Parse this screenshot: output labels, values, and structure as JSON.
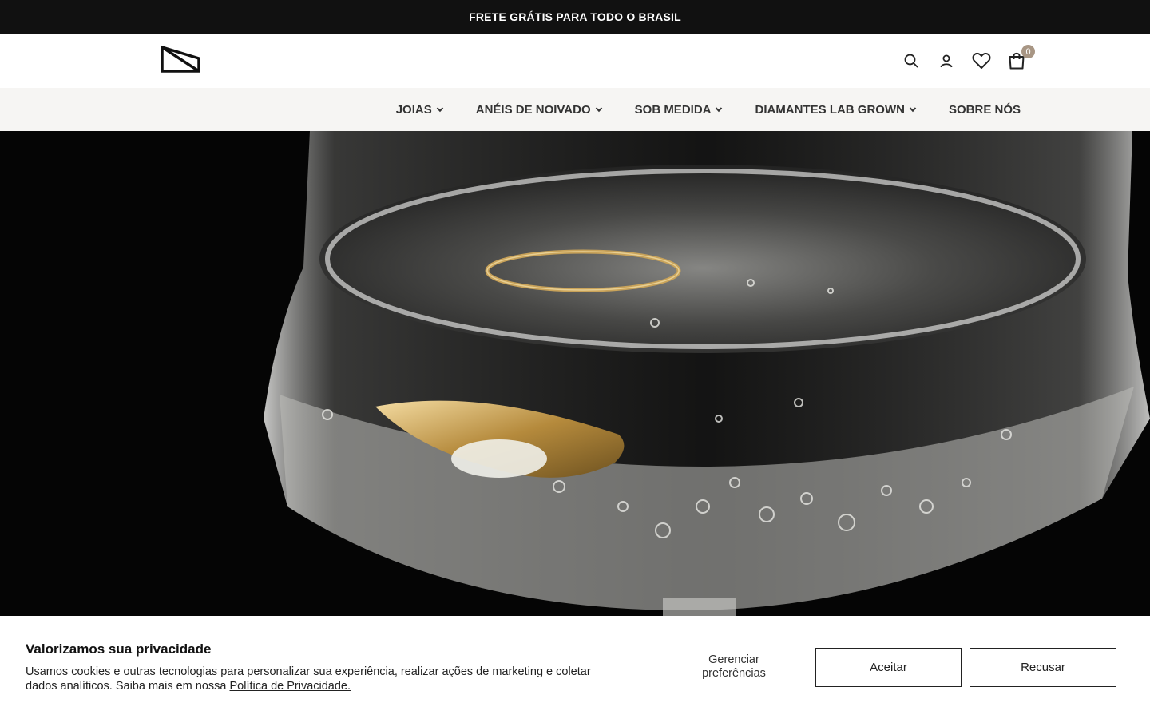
{
  "announcement": {
    "text": "FRETE GRÁTIS PARA TODO O BRASIL"
  },
  "header": {
    "logo_icon": "logo-mark",
    "icons": [
      "search-icon",
      "user-icon",
      "heart-icon",
      "bag-icon"
    ],
    "cart_count": "0"
  },
  "nav": {
    "items": [
      {
        "label": "JOIAS",
        "has_dropdown": true
      },
      {
        "label": "ANÉIS DE NOIVADO",
        "has_dropdown": true
      },
      {
        "label": "SOB MEDIDA",
        "has_dropdown": true
      },
      {
        "label": "DIAMANTES LAB GROWN",
        "has_dropdown": true
      },
      {
        "label": "SOBRE NÓS",
        "has_dropdown": false
      }
    ]
  },
  "cookie": {
    "title": "Valorizamos sua privacidade",
    "text": "Usamos cookies e outras tecnologias para personalizar sua experiência, realizar ações de marketing e coletar dados analíticos. Saiba mais em nossa ",
    "link": "Política de Privacidade.",
    "manage_label": "Gerenciar preferências",
    "accept_label": "Aceitar",
    "reject_label": "Recusar"
  },
  "colors": {
    "announcement_bg": "#111111",
    "nav_bg": "#f6f5f3",
    "cart_badge": "#a89684"
  }
}
